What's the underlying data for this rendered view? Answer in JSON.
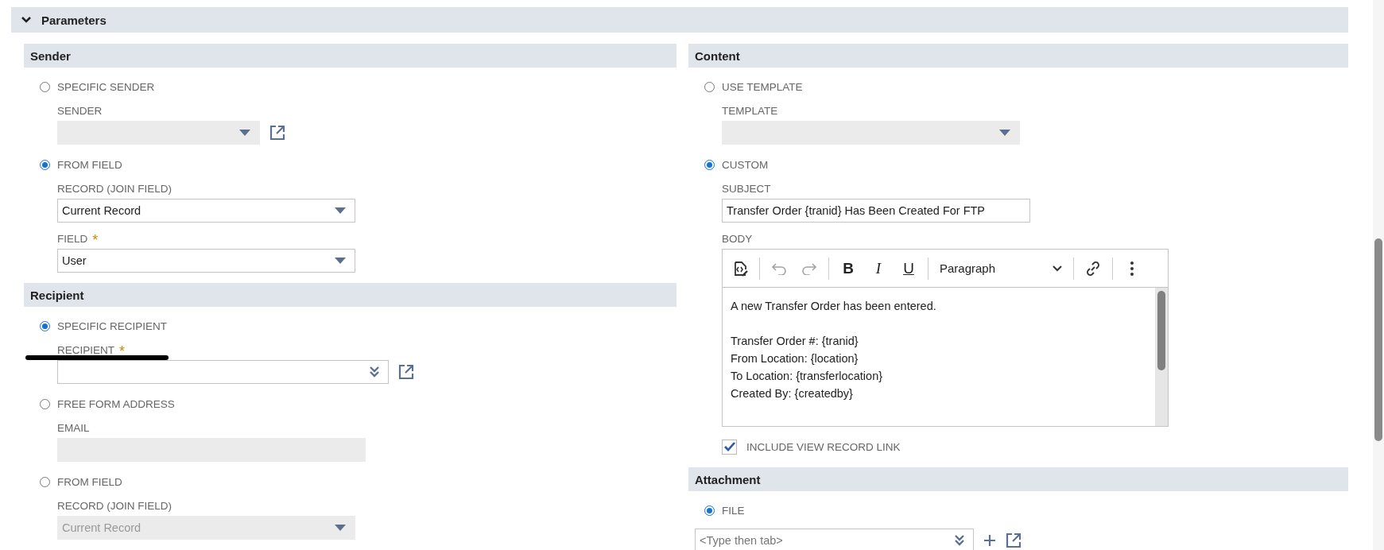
{
  "section": {
    "title": "Parameters",
    "expanded": true
  },
  "columns": [
    [
      {
        "title": "Sender",
        "items": [
          {
            "kind": "radio",
            "label": "SPECIFIC SENDER",
            "selected": false
          },
          {
            "kind": "select",
            "label": "SENDER",
            "disabled": true,
            "link": true
          },
          {
            "kind": "radio",
            "label": "FROM FIELD",
            "selected": true
          },
          {
            "kind": "select",
            "label": "RECORD (JOIN FIELD)",
            "value": "Current Record",
            "disabled": false
          },
          {
            "kind": "select",
            "label": "FIELD",
            "required_mark": "*",
            "value": "User",
            "disabled": false
          }
        ]
      },
      {
        "title": "Recipient",
        "items": [
          {
            "kind": "radio",
            "label": "SPECIFIC RECIPIENT",
            "selected": true
          },
          {
            "kind": "lookup",
            "label": "RECIPIENT",
            "required_mark": "*",
            "redacted": true,
            "link": true
          },
          {
            "kind": "radio",
            "label": "FREE FORM ADDRESS",
            "selected": false
          },
          {
            "kind": "text",
            "label": "EMAIL",
            "disabled": true
          },
          {
            "kind": "radio",
            "label": "FROM FIELD",
            "selected": false
          },
          {
            "kind": "select",
            "label": "RECORD (JOIN FIELD)",
            "value": "Current Record",
            "disabled": true
          }
        ]
      }
    ],
    [
      {
        "title": "Content",
        "items": [
          {
            "kind": "radio",
            "label": "USE TEMPLATE",
            "selected": false
          },
          {
            "kind": "select",
            "label": "TEMPLATE",
            "disabled": true
          },
          {
            "kind": "radio",
            "label": "CUSTOM",
            "selected": true
          },
          {
            "kind": "text",
            "label": "SUBJECT",
            "value": "Transfer Order {tranid} Has Been Created For FTP",
            "disabled": false
          },
          {
            "kind": "editor",
            "label": "BODY",
            "toolbar": [
              {
                "kind": "source",
                "disabled": false
              },
              {
                "kind": "undo",
                "disabled": true
              },
              {
                "kind": "redo",
                "disabled": true
              },
              {
                "kind": "bold",
                "label": "B",
                "disabled": false
              },
              {
                "kind": "italic",
                "label": "I",
                "disabled": false
              },
              {
                "kind": "underline",
                "label": "U",
                "disabled": false
              },
              {
                "kind": "format",
                "label": "Paragraph",
                "disabled": false
              },
              {
                "kind": "link",
                "disabled": false
              },
              {
                "kind": "more",
                "disabled": false
              }
            ],
            "paragraphs": [
              [
                "A new Transfer Order has been entered."
              ],
              [
                "Transfer Order #: {tranid}",
                "From Location: {location}",
                "To Location: {transferlocation}",
                "Created By: {createdby}"
              ]
            ]
          },
          {
            "kind": "checkbox",
            "label": "INCLUDE VIEW RECORD LINK",
            "checked": true
          }
        ]
      },
      {
        "title": "Attachment",
        "items": [
          {
            "kind": "radio",
            "label": "FILE",
            "selected": true
          },
          {
            "kind": "lookup",
            "placeholder": "<Type then tab>",
            "add": true,
            "link": true
          }
        ]
      }
    ]
  ]
}
